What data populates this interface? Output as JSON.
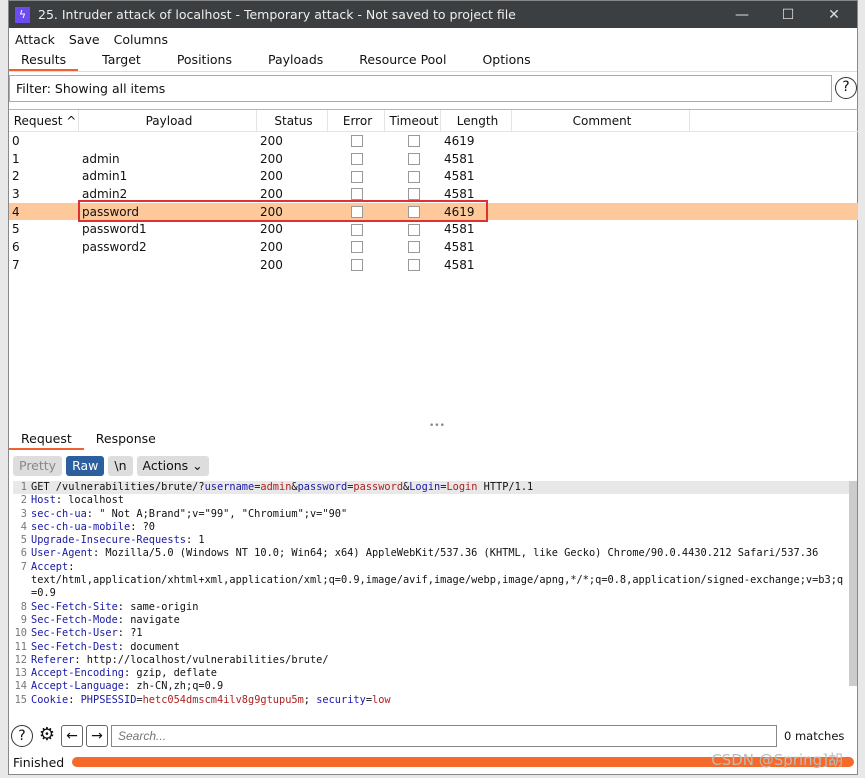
{
  "window": {
    "title": "25. Intruder attack of localhost - Temporary attack - Not saved to project file",
    "logo": "ϟ",
    "minimize": "—",
    "maximize": "☐",
    "close": "✕"
  },
  "menu": [
    "Attack",
    "Save",
    "Columns"
  ],
  "tabs": [
    "Results",
    "Target",
    "Positions",
    "Payloads",
    "Resource Pool",
    "Options"
  ],
  "filter": {
    "text": "Filter: Showing all items",
    "help": "?"
  },
  "table": {
    "columns": [
      "Request ^",
      "Payload",
      "Status",
      "Error",
      "Timeout",
      "Length",
      "Comment"
    ],
    "rows": [
      {
        "request": "0",
        "payload": "",
        "status": "200",
        "error": false,
        "timeout": false,
        "length": "4619"
      },
      {
        "request": "1",
        "payload": "admin",
        "status": "200",
        "error": false,
        "timeout": false,
        "length": "4581"
      },
      {
        "request": "2",
        "payload": "admin1",
        "status": "200",
        "error": false,
        "timeout": false,
        "length": "4581"
      },
      {
        "request": "3",
        "payload": "admin2",
        "status": "200",
        "error": false,
        "timeout": false,
        "length": "4581"
      },
      {
        "request": "4",
        "payload": "password",
        "status": "200",
        "error": false,
        "timeout": false,
        "length": "4619",
        "selected": true
      },
      {
        "request": "5",
        "payload": "password1",
        "status": "200",
        "error": false,
        "timeout": false,
        "length": "4581"
      },
      {
        "request": "6",
        "payload": "password2",
        "status": "200",
        "error": false,
        "timeout": false,
        "length": "4581"
      },
      {
        "request": "7",
        "payload": "",
        "status": "200",
        "error": false,
        "timeout": false,
        "length": "4581"
      }
    ]
  },
  "detail_tabs": [
    "Request",
    "Response"
  ],
  "toolbar": {
    "pretty": "Pretty",
    "raw": "Raw",
    "newline": "\\n",
    "actions": "Actions ⌄"
  },
  "request_lines": [
    [
      [
        "GET /vulnerabilities/brute/?",
        ""
      ],
      [
        "username",
        "k"
      ],
      [
        "=",
        ""
      ],
      [
        "admin",
        "v"
      ],
      [
        "&",
        ""
      ],
      [
        "password",
        "k"
      ],
      [
        "=",
        ""
      ],
      [
        "password",
        "v"
      ],
      [
        "&",
        ""
      ],
      [
        "Login",
        "k"
      ],
      [
        "=",
        ""
      ],
      [
        "Login",
        "v"
      ],
      [
        " HTTP/1.1",
        ""
      ]
    ],
    [
      [
        "Host",
        "k"
      ],
      [
        ": localhost",
        ""
      ]
    ],
    [
      [
        "sec-ch-ua",
        "k"
      ],
      [
        ": \" Not A;Brand\";v=\"99\", \"Chromium\";v=\"90\"",
        ""
      ]
    ],
    [
      [
        "sec-ch-ua-mobile",
        "k"
      ],
      [
        ": ?0",
        ""
      ]
    ],
    [
      [
        "Upgrade-Insecure-Requests",
        "k"
      ],
      [
        ": 1",
        ""
      ]
    ],
    [
      [
        "User-Agent",
        "k"
      ],
      [
        ": Mozilla/5.0 (Windows NT 10.0; Win64; x64) AppleWebKit/537.36 (KHTML, like Gecko) Chrome/90.0.4430.212 Safari/537.36",
        ""
      ]
    ],
    [
      [
        "Accept",
        "k"
      ],
      [
        ":\ntext/html,application/xhtml+xml,application/xml;q=0.9,image/avif,image/webp,image/apng,*/*;q=0.8,application/signed-exchange;v=b3;q=0.9",
        ""
      ]
    ],
    [
      [
        "Sec-Fetch-Site",
        "k"
      ],
      [
        ": same-origin",
        ""
      ]
    ],
    [
      [
        "Sec-Fetch-Mode",
        "k"
      ],
      [
        ": navigate",
        ""
      ]
    ],
    [
      [
        "Sec-Fetch-User",
        "k"
      ],
      [
        ": ?1",
        ""
      ]
    ],
    [
      [
        "Sec-Fetch-Dest",
        "k"
      ],
      [
        ": document",
        ""
      ]
    ],
    [
      [
        "Referer",
        "k"
      ],
      [
        ": http://localhost/vulnerabilities/brute/",
        ""
      ]
    ],
    [
      [
        "Accept-Encoding",
        "k"
      ],
      [
        ": gzip, deflate",
        ""
      ]
    ],
    [
      [
        "Accept-Language",
        "k"
      ],
      [
        ": zh-CN,zh;q=0.9",
        ""
      ]
    ],
    [
      [
        "Cookie",
        "k"
      ],
      [
        ": ",
        ""
      ],
      [
        "PHPSESSID",
        "k"
      ],
      [
        "=",
        ""
      ],
      [
        "hetc054dmscm4ilv8g9gtupu5m",
        "v"
      ],
      [
        "; ",
        ""
      ],
      [
        "security",
        "k"
      ],
      [
        "=",
        ""
      ],
      [
        "low",
        "v"
      ]
    ]
  ],
  "bottom": {
    "help": "?",
    "settings": "⚙",
    "back": "←",
    "forward": "→",
    "search_placeholder": "Search...",
    "matches": "0 matches"
  },
  "status": {
    "text": "Finished",
    "progress": 1.0
  },
  "watermark": "CSDN @Spring]胡"
}
